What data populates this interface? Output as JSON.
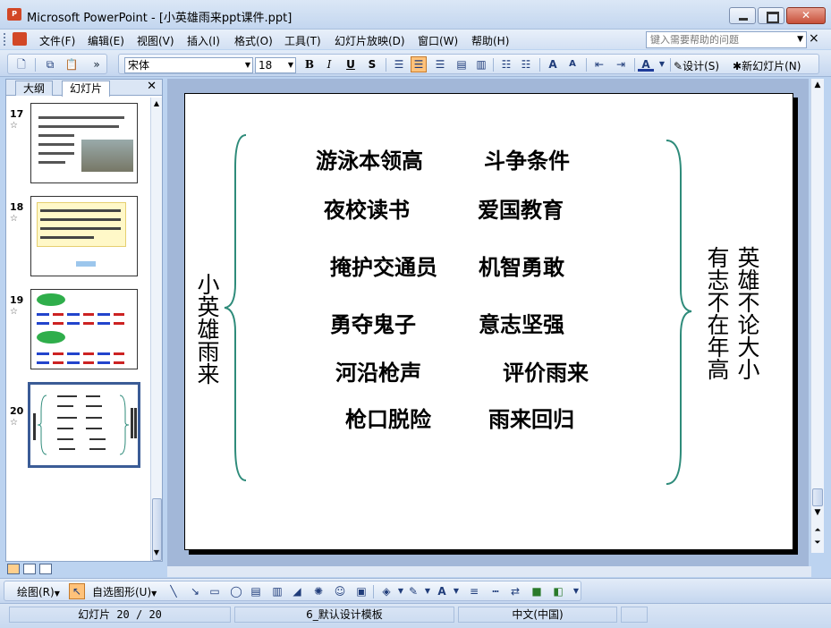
{
  "window": {
    "title": "Microsoft PowerPoint - [小英雄雨来ppt课件.ppt]",
    "icon_label": "P"
  },
  "menu": {
    "items": [
      "文件(F)",
      "编辑(E)",
      "视图(V)",
      "插入(I)",
      "格式(O)",
      "工具(T)",
      "幻灯片放映(D)",
      "窗口(W)",
      "帮助(H)"
    ],
    "help_placeholder": "键入需要帮助的问题"
  },
  "toolbar": {
    "font_name": "宋体",
    "font_size": "18",
    "bold": "B",
    "italic": "I",
    "underline": "U",
    "shadow": "S",
    "design_label": "设计(S)",
    "new_slide_label": "新幻灯片(N)"
  },
  "panel": {
    "tab_outline": "大纲",
    "tab_slides": "幻灯片",
    "slides": [
      {
        "number": "17"
      },
      {
        "number": "18"
      },
      {
        "number": "19"
      },
      {
        "number": "20",
        "selected": true
      }
    ]
  },
  "slide": {
    "left_vertical": "小英雄雨来",
    "right_vertical_1": "英雄不论大小",
    "right_vertical_2": "有志不在年高",
    "rows": [
      {
        "left": "游泳本领高",
        "right": "斗争条件"
      },
      {
        "left": "夜校读书",
        "right": "爱国教育"
      },
      {
        "left": "掩护交通员",
        "right": "机智勇敢"
      },
      {
        "left": "勇夺鬼子",
        "right": "意志坚强"
      },
      {
        "left": "河沿枪声",
        "right": "评价雨来"
      },
      {
        "left": "枪口脱险",
        "right": "雨来回归"
      }
    ],
    "brace_color": "#2e8b7a"
  },
  "draw_toolbar": {
    "draw_label": "绘图(R)",
    "autoshape_label": "自选图形(U)"
  },
  "status": {
    "slide_pos": "幻灯片 20 / 20",
    "template": "6_默认设计模板",
    "language": "中文(中国)"
  }
}
